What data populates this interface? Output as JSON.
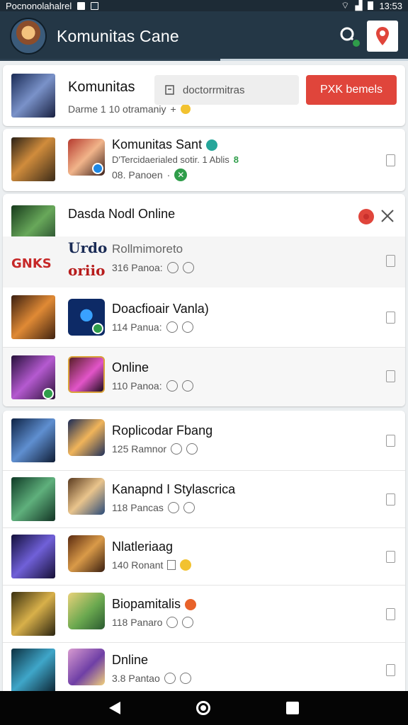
{
  "status_bar": {
    "left_text": "Pocnonolahalrel",
    "time": "13:53"
  },
  "app_bar": {
    "title": "Komunitas Cane"
  },
  "top_card": {
    "title": "Komunitas",
    "subtitle": "Darme 1 10 otramaniy",
    "search_placeholder": "doctorrmitras",
    "button_label": "PXK bemels"
  },
  "featured": {
    "title": "Komunitas Sant",
    "desc": "D'Tercidaerialed sotir. 1 Ablis",
    "desc_num": "8",
    "meta": "08. Panoen"
  },
  "section": {
    "title": "Dasda Nodl Online",
    "items": [
      {
        "title": "Rollmimoreto",
        "meta": "316 Panoa:",
        "logo_top": "Urdo",
        "logo_mid": "GNKS",
        "logo_bot": "oriio"
      },
      {
        "title": "Doacfioair Vanla)",
        "meta": "114 Panua:"
      },
      {
        "title": "Online",
        "meta": "110 Panoa:"
      }
    ]
  },
  "list": [
    {
      "title": "Roplicodar Fbang",
      "meta": "125 Ramnor"
    },
    {
      "title": "Kanapnd I Stylascrica",
      "meta": "118 Pancas"
    },
    {
      "title": "Nlatleriaag",
      "meta": "140 Ronant"
    },
    {
      "title": "Biopamitalis",
      "meta": "118 Panaro"
    },
    {
      "title": "Dnline",
      "meta": "3.8 Pantao"
    }
  ],
  "icons": [
    "search-icon",
    "map-pin-icon",
    "edit-icon",
    "gear-icon",
    "close-icon",
    "document-icon",
    "back-icon",
    "home-icon",
    "recent-apps-icon"
  ],
  "colors": {
    "app_bar": "#243746",
    "accent_red": "#e0453b",
    "accent_green": "#2f9d4a"
  }
}
